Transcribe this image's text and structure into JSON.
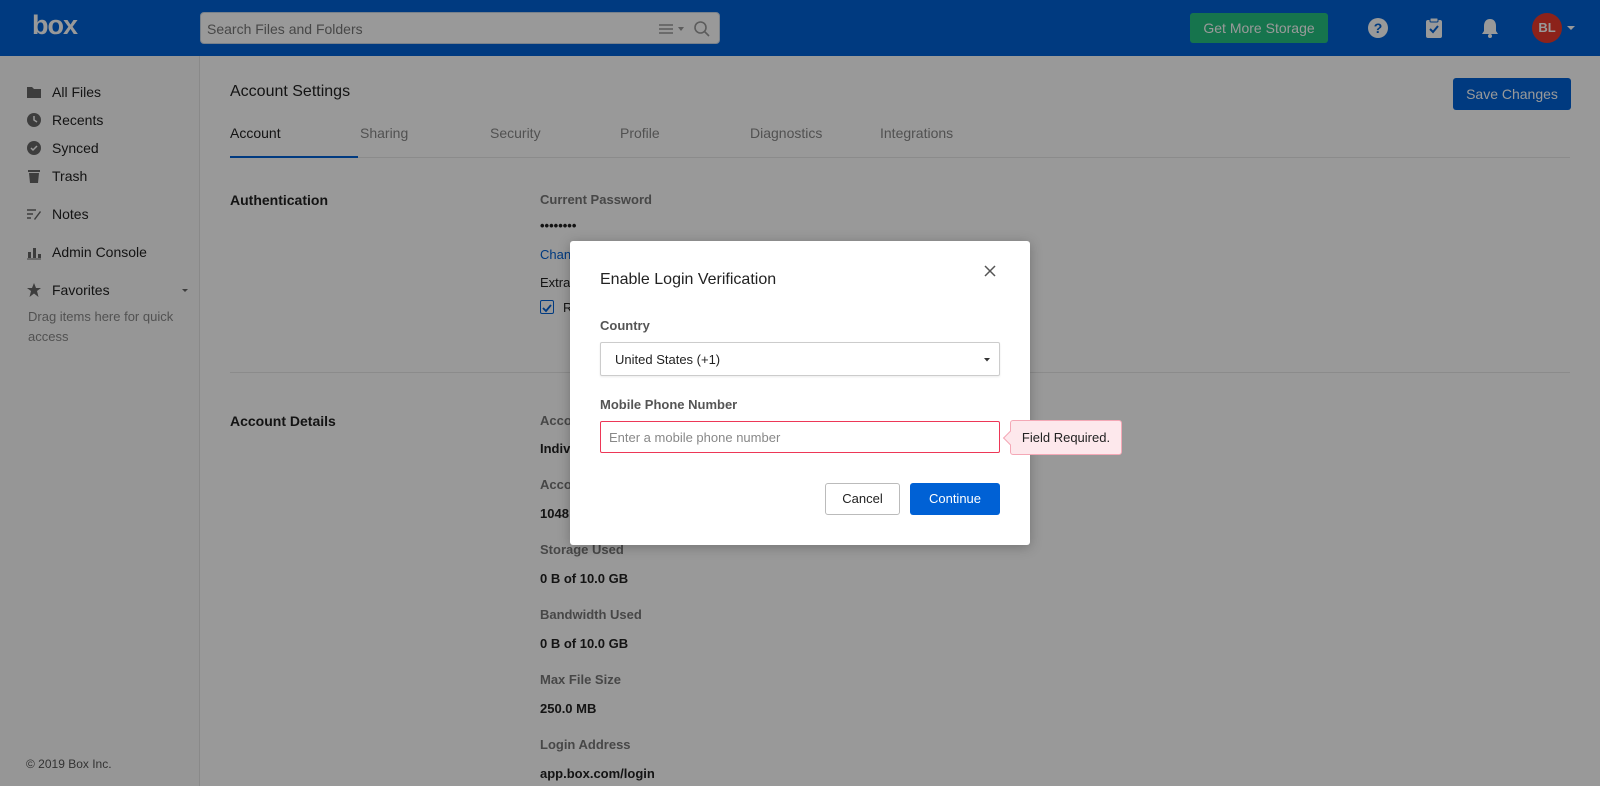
{
  "header": {
    "logo": "box",
    "search_placeholder": "Search Files and Folders",
    "storage_button": "Get More Storage",
    "avatar_initials": "BL",
    "brand_color": "#0061d5",
    "storage_color": "#26c281"
  },
  "sidebar": {
    "items": [
      {
        "label": "All Files",
        "icon": "folder-icon"
      },
      {
        "label": "Recents",
        "icon": "clock-icon"
      },
      {
        "label": "Synced",
        "icon": "sync-icon"
      },
      {
        "label": "Trash",
        "icon": "trash-icon"
      },
      {
        "label": "Notes",
        "icon": "notes-icon"
      },
      {
        "label": "Admin Console",
        "icon": "chart-icon"
      },
      {
        "label": "Favorites",
        "icon": "star-icon"
      }
    ],
    "favorites_hint": "Drag items here for quick access",
    "copyright": "© 2019 Box Inc."
  },
  "main": {
    "title": "Account Settings",
    "save_button": "Save Changes",
    "tabs": [
      "Account",
      "Sharing",
      "Security",
      "Profile",
      "Diagnostics",
      "Integrations"
    ],
    "active_tab": "Account",
    "authentication": {
      "section": "Authentication",
      "current_password_label": "Current Password",
      "password_mask": "••••••••",
      "change_link": "Chan",
      "extra_label": "Extra",
      "checkbox_label": "R"
    },
    "account_details": {
      "section": "Account Details",
      "fields": [
        {
          "label": "Acco",
          "value": "Indiv"
        },
        {
          "label": "Acco",
          "value": "1048"
        },
        {
          "label": "Storage Used",
          "value": "0 B of 10.0 GB"
        },
        {
          "label": "Bandwidth Used",
          "value": "0 B of 10.0 GB"
        },
        {
          "label": "Max File Size",
          "value": "250.0 MB"
        },
        {
          "label": "Login Address",
          "value": "app.box.com/login"
        }
      ]
    }
  },
  "modal": {
    "title": "Enable Login Verification",
    "country_label": "Country",
    "country_value": "United States (+1)",
    "phone_label": "Mobile Phone Number",
    "phone_placeholder": "Enter a mobile phone number",
    "phone_value": "",
    "error_tooltip": "Field Required.",
    "cancel_button": "Cancel",
    "continue_button": "Continue",
    "error_color": "#ed3757"
  }
}
